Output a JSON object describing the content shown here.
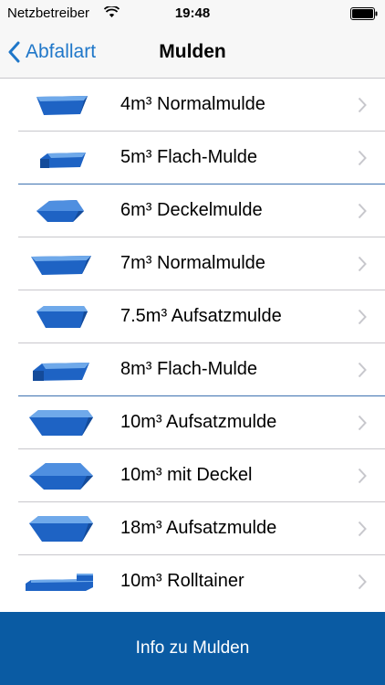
{
  "status_bar": {
    "carrier": "Netzbetreiber",
    "time": "19:48"
  },
  "nav": {
    "back_label": "Abfallart",
    "title": "Mulden"
  },
  "items": [
    {
      "label": "4m³ Normalmulde",
      "icon": "normalmulde-icon"
    },
    {
      "label": "5m³ Flach-Mulde",
      "icon": "flachmulde-icon"
    },
    {
      "label": "6m³ Deckelmulde",
      "icon": "deckelmulde-icon"
    },
    {
      "label": "7m³ Normalmulde",
      "icon": "normalmulde-icon"
    },
    {
      "label": "7.5m³ Aufsatzmulde",
      "icon": "aufsatzmulde-icon"
    },
    {
      "label": "8m³ Flach-Mulde",
      "icon": "flachmulde-icon"
    },
    {
      "label": "10m³ Aufsatzmulde",
      "icon": "aufsatzmulde-icon"
    },
    {
      "label": "10m³ mit Deckel",
      "icon": "deckelmulde-icon"
    },
    {
      "label": "18m³ Aufsatzmulde",
      "icon": "aufsatzmulde-icon"
    },
    {
      "label": "10m³ Rolltainer",
      "icon": "rolltainer-icon"
    }
  ],
  "footer": {
    "button_label": "Info zu Mulden"
  },
  "colors": {
    "accent": "#1f77c9",
    "footer_bg": "#0a5ba3",
    "container_blue": "#1e63c4"
  }
}
